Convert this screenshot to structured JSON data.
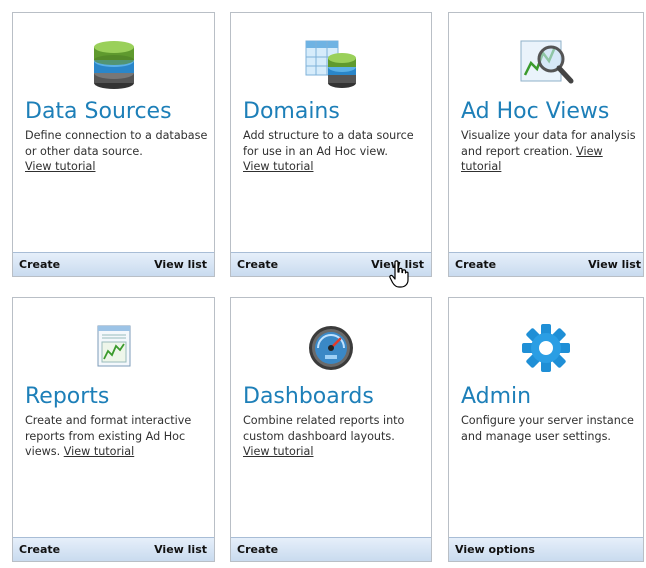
{
  "cards": [
    {
      "title": "Data Sources",
      "desc": "Define connection to a database or other data source.",
      "link": "View tutorial",
      "create": "Create",
      "view_list": "View list",
      "icon": "database-icon"
    },
    {
      "title": "Domains",
      "desc": "Add structure to a data source for use in an Ad Hoc view.",
      "link": "View tutorial",
      "create": "Create",
      "view_list": "View list",
      "icon": "domain-table-icon"
    },
    {
      "title": "Ad Hoc Views",
      "desc": "Visualize your data for analysis and report creation.",
      "link": "View tutorial",
      "create": "Create",
      "view_list": "View list",
      "icon": "chart-magnifier-icon"
    },
    {
      "title": "Reports",
      "desc": "Create and format interactive reports from existing Ad Hoc views.",
      "link": "View tutorial",
      "create": "Create",
      "view_list": "View list",
      "icon": "report-icon"
    },
    {
      "title": "Dashboards",
      "desc": "Combine related reports into custom dashboard layouts.",
      "link": "View tutorial",
      "create": "Create",
      "icon": "gauge-icon"
    },
    {
      "title": "Admin",
      "desc": "Configure your server instance and manage user settings.",
      "view_options": "View options",
      "icon": "gear-icon"
    }
  ],
  "colors": {
    "title": "#1d7fb8",
    "footer_top": "#e6effa",
    "footer_bottom": "#c9dbef",
    "border": "#b9bfc6"
  }
}
